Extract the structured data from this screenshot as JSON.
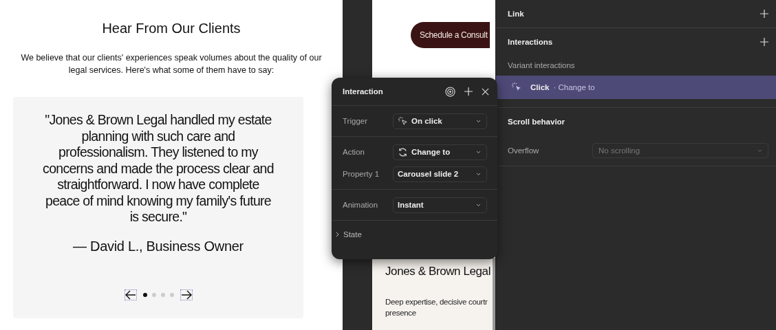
{
  "testimonials": {
    "title": "Hear From Our Clients",
    "intro": "We believe that our clients' experiences speak volumes about the quality of our legal services. Here's what some of them have to say:",
    "quote": "\"Jones & Brown Legal handled my estate planning with such care and professionalism. They listened to my concerns and made the process clear and straightforward. I now have complete peace of mind knowing my family's future is secure.\"",
    "author": "— David L., Business Owner",
    "dots": [
      {
        "selected": true
      },
      {
        "selected": false
      },
      {
        "selected": false
      },
      {
        "selected": false
      }
    ]
  },
  "canvas": {
    "button": "Schedule a Consult",
    "brand": "Jones & Brown Legal",
    "tagline_lines": [
      "Deep expertise, decisive courtr",
      "presence"
    ]
  },
  "interaction_popup": {
    "title": "Interaction",
    "groups": [
      [
        {
          "label": "Trigger",
          "value": "On click",
          "kind": "trigger"
        }
      ],
      [
        {
          "label": "Action",
          "value": "Change to",
          "kind": "action"
        },
        {
          "label": "Property 1",
          "value": "Carousel slide 2",
          "kind": "plain"
        }
      ],
      [
        {
          "label": "Animation",
          "value": "Instant",
          "kind": "plain"
        }
      ]
    ],
    "state": {
      "label": "State",
      "expanded": false
    }
  },
  "properties_panel": {
    "link": "Link",
    "interactions": "Interactions",
    "variant_interactions": "Variant interactions",
    "interaction_items": [
      {
        "trigger": "Click",
        "action": "· Change to",
        "selected": true
      }
    ],
    "scroll_title": "Scroll behavior",
    "overflow_label": "Overflow",
    "overflow_value": "No scrolling"
  }
}
